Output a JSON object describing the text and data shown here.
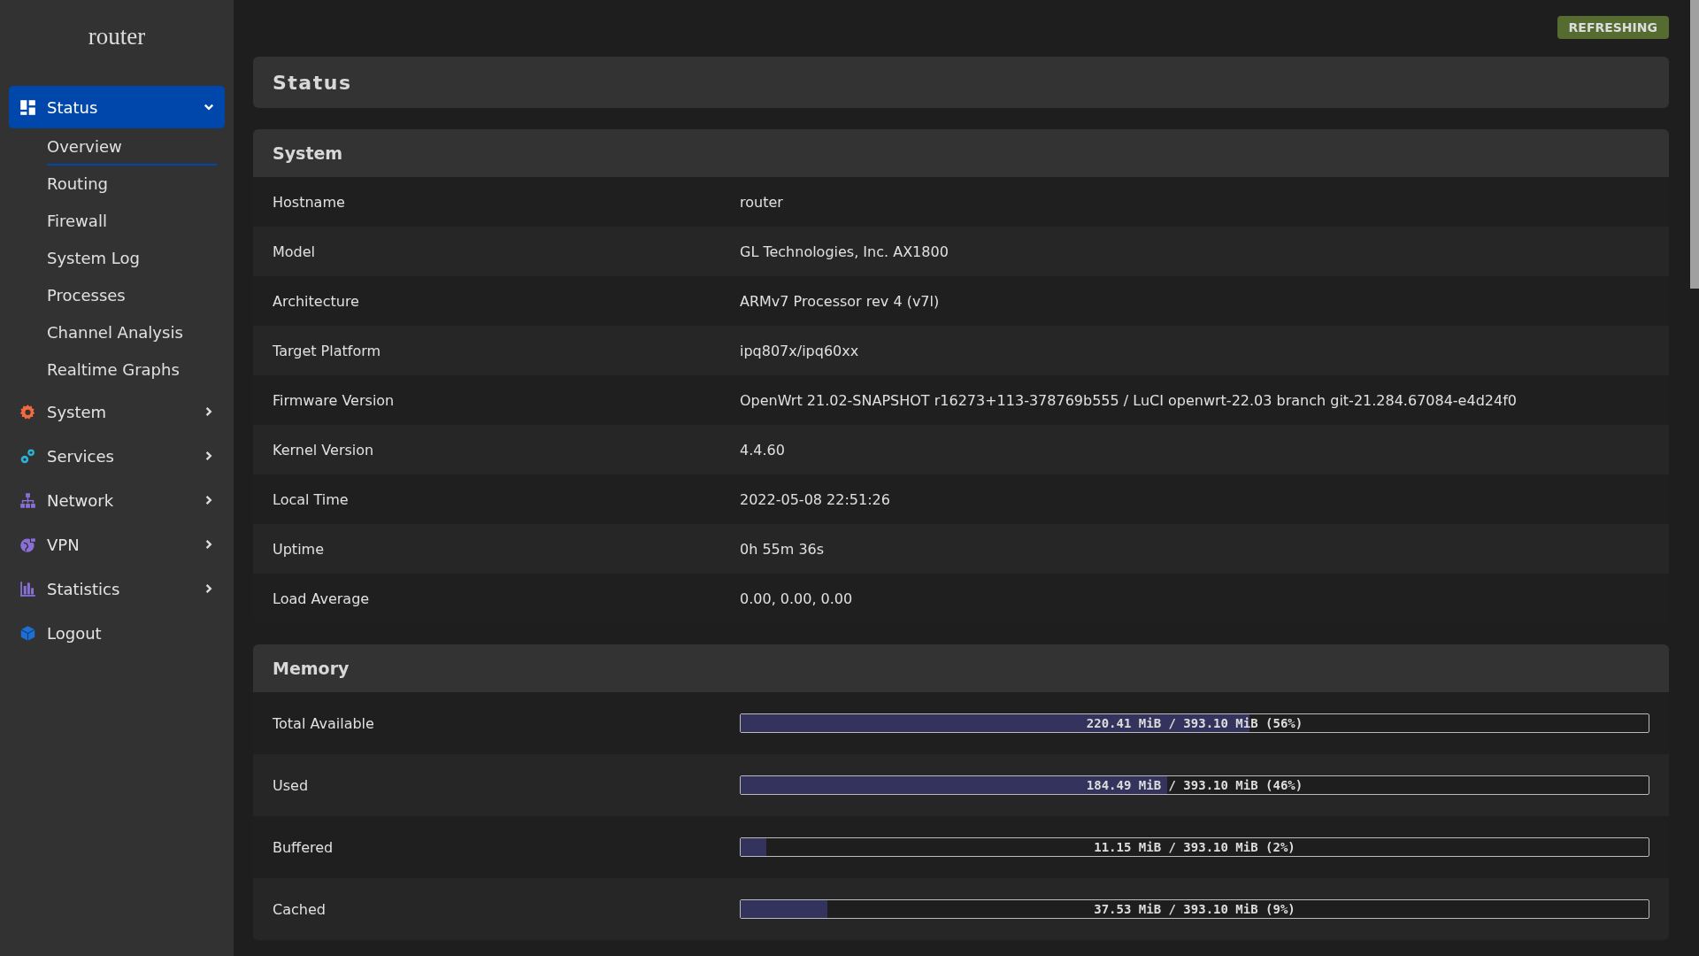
{
  "sidebar": {
    "logo": "router",
    "items": [
      {
        "label": "Status",
        "expanded": true,
        "selected": true,
        "children": [
          {
            "label": "Overview",
            "selected": true
          },
          {
            "label": "Routing",
            "selected": false
          },
          {
            "label": "Firewall",
            "selected": false
          },
          {
            "label": "System Log",
            "selected": false
          },
          {
            "label": "Processes",
            "selected": false
          },
          {
            "label": "Channel Analysis",
            "selected": false
          },
          {
            "label": "Realtime Graphs",
            "selected": false
          }
        ]
      },
      {
        "label": "System",
        "expanded": false,
        "selected": false
      },
      {
        "label": "Services",
        "expanded": false,
        "selected": false
      },
      {
        "label": "Network",
        "expanded": false,
        "selected": false
      },
      {
        "label": "VPN",
        "expanded": false,
        "selected": false
      },
      {
        "label": "Statistics",
        "expanded": false,
        "selected": false
      },
      {
        "label": "Logout",
        "selected": false
      }
    ]
  },
  "badge": "REFRESHING",
  "page_title": "Status",
  "sections": [
    {
      "title": "System",
      "rows": [
        {
          "label": "Hostname",
          "value": "router"
        },
        {
          "label": "Model",
          "value": "GL Technologies, Inc. AX1800"
        },
        {
          "label": "Architecture",
          "value": "ARMv7 Processor rev 4 (v7l)"
        },
        {
          "label": "Target Platform",
          "value": "ipq807x/ipq60xx"
        },
        {
          "label": "Firmware Version",
          "value": "OpenWrt 21.02-SNAPSHOT r16273+113-378769b555 / LuCI openwrt-22.03 branch git-21.284.67084-e4d24f0"
        },
        {
          "label": "Kernel Version",
          "value": "4.4.60"
        },
        {
          "label": "Local Time",
          "value": "2022-05-08 22:51:26"
        },
        {
          "label": "Uptime",
          "value": "0h 55m 36s"
        },
        {
          "label": "Load Average",
          "value": "0.00, 0.00, 0.00"
        }
      ]
    },
    {
      "title": "Memory",
      "rows": [
        {
          "label": "Total Available",
          "level": 0.5607,
          "reading": "220.41 MiB / 393.10 MiB (56%)"
        },
        {
          "label": "Used",
          "level": 0.4693,
          "reading": "184.49 MiB / 393.10 MiB (46%)"
        },
        {
          "label": "Buffered",
          "level": 0.0284,
          "reading": "11.15 MiB / 393.10 MiB (2%)"
        },
        {
          "label": "Cached",
          "level": 0.0955,
          "reading": "37.53 MiB / 393.10 MiB (9%)"
        }
      ]
    }
  ]
}
